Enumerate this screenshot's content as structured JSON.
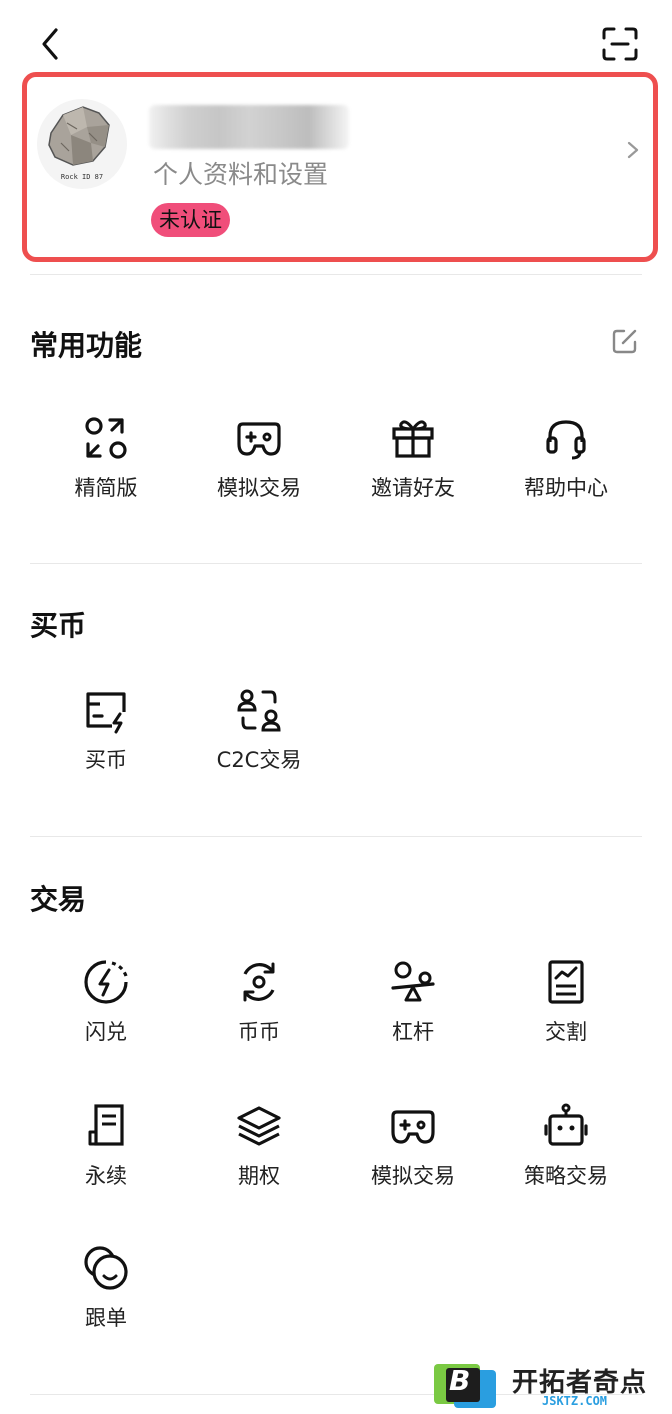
{
  "profile": {
    "subtitle": "个人资料和设置",
    "status_badge": "未认证",
    "avatar_caption": "Rock ID 87"
  },
  "sections": {
    "common": {
      "title": "常用功能",
      "items": [
        {
          "label": "精简版",
          "icon": "lite-mode-icon"
        },
        {
          "label": "模拟交易",
          "icon": "gamepad-icon"
        },
        {
          "label": "邀请好友",
          "icon": "gift-icon"
        },
        {
          "label": "帮助中心",
          "icon": "headset-icon"
        }
      ]
    },
    "buy": {
      "title": "买币",
      "items": [
        {
          "label": "买币",
          "icon": "card-flash-icon"
        },
        {
          "label": "C2C交易",
          "icon": "c2c-users-icon"
        }
      ]
    },
    "trade": {
      "title": "交易",
      "items": [
        {
          "label": "闪兑",
          "icon": "flash-swap-icon"
        },
        {
          "label": "币币",
          "icon": "coin-exchange-icon"
        },
        {
          "label": "杠杆",
          "icon": "leverage-icon"
        },
        {
          "label": "交割",
          "icon": "delivery-doc-icon"
        },
        {
          "label": "永续",
          "icon": "perpetual-doc-icon"
        },
        {
          "label": "期权",
          "icon": "layers-icon"
        },
        {
          "label": "模拟交易",
          "icon": "gamepad-icon"
        },
        {
          "label": "策略交易",
          "icon": "robot-icon"
        },
        {
          "label": "跟单",
          "icon": "copy-trade-icon"
        }
      ]
    }
  },
  "watermark": {
    "text": "开拓者奇点",
    "sub": "JSKTZ.COM",
    "logo_letter": "B"
  },
  "colors": {
    "highlight_border": "#ee4f4f",
    "badge_bg": "#f04e7a",
    "watermark_blue": "#2a9ee0",
    "watermark_green": "#7ac943"
  }
}
